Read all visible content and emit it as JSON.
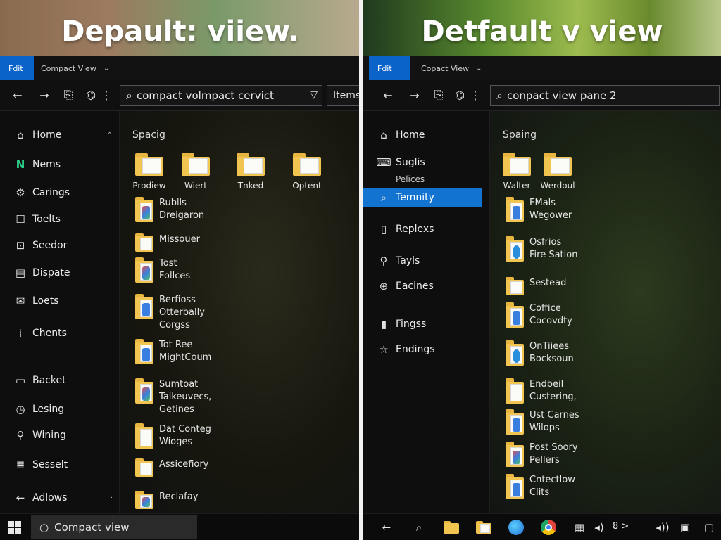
{
  "left": {
    "banner_title": "Depault: viiew.",
    "app_tab": "Fdit",
    "view_label": "Compact View",
    "search_value": "compact volmpact cervict",
    "items_label": "Items",
    "sidebar": [
      {
        "icon": "home-icon",
        "label": "Home",
        "glyph": "⌂"
      },
      {
        "icon": "news-icon",
        "label": "Nems",
        "glyph": "N"
      },
      {
        "icon": "settings-icon",
        "label": "Carings",
        "glyph": "⚙"
      },
      {
        "icon": "tools-icon",
        "label": "Toelts",
        "glyph": "☐"
      },
      {
        "icon": "selector-icon",
        "label": "Seedor",
        "glyph": "⊡"
      },
      {
        "icon": "document-icon",
        "label": "Dispate",
        "glyph": "▤"
      },
      {
        "icon": "mail-icon",
        "label": "Loets",
        "glyph": "✉"
      },
      {
        "icon": "grid-icon",
        "label": "Chents",
        "glyph": "⁞"
      },
      {
        "icon": "monitor-icon",
        "label": "Backet",
        "glyph": "▭"
      },
      {
        "icon": "clock-icon",
        "label": "Lesing",
        "glyph": "◷"
      },
      {
        "icon": "wrench-icon",
        "label": "Wining",
        "glyph": "⚲"
      },
      {
        "icon": "list-icon",
        "label": "Sesselt",
        "glyph": "≣"
      },
      {
        "icon": "back-arrow-icon",
        "label": "Adlows",
        "glyph": "←"
      }
    ],
    "section_title": "Spacig",
    "grid": [
      "Prodiew",
      "Wiert",
      "Tnked",
      "Optent"
    ],
    "list": [
      {
        "lines": [
          "Rublls",
          "Dreigaron"
        ],
        "mark": "colors"
      },
      {
        "lines": [
          "Missouer"
        ],
        "mark": "none"
      },
      {
        "lines": [
          "Tost",
          "Follces"
        ],
        "mark": "colors"
      },
      {
        "lines": [
          "Berfioss",
          "Otterbally",
          "Corgss"
        ],
        "mark": "blue"
      },
      {
        "lines": [
          "Tot Ree",
          "MightCoum"
        ],
        "mark": "blue"
      },
      {
        "lines": [
          "Sumtoat",
          "Talkeuvecs,",
          "Getines"
        ],
        "mark": "colors"
      },
      {
        "lines": [
          "Dat Conteg",
          "Wioges"
        ],
        "mark": "none"
      },
      {
        "lines": [
          "Assicefiory"
        ],
        "mark": "none"
      },
      {
        "lines": [
          "Reclafay"
        ],
        "mark": "colors"
      }
    ],
    "taskbar_search": "Compact view"
  },
  "right": {
    "banner_title": "Detfault v view",
    "app_tab": "Fdit",
    "view_label": "Copact View",
    "search_value": "conpact view pane 2",
    "sidebar": [
      {
        "icon": "home-icon",
        "label": "Home",
        "glyph": "⌂"
      },
      {
        "icon": "keyboard-icon",
        "label": "Suglis",
        "glyph": "⌨"
      },
      {
        "icon": "terminal-icon",
        "label": "Temnity",
        "glyph": "⌕"
      },
      {
        "icon": "document-icon",
        "label": "Replexs",
        "glyph": "▯"
      },
      {
        "icon": "tools-icon",
        "label": "Tayls",
        "glyph": "⚲"
      },
      {
        "icon": "globe-icon",
        "label": "Eacines",
        "glyph": "⊕"
      },
      {
        "icon": "bookmark-icon",
        "label": "Fingss",
        "glyph": "▮"
      },
      {
        "icon": "star-icon",
        "label": "Endings",
        "glyph": "☆"
      }
    ],
    "sidebar_sub": "Pelices",
    "section_title": "Spaing",
    "grid": [
      "Walter",
      "Werdoul"
    ],
    "list": [
      {
        "lines": [
          "FMals",
          "Wegower"
        ],
        "mark": "blue"
      },
      {
        "lines": [
          "Osfrios",
          "Fire Sation"
        ],
        "mark": "edge"
      },
      {
        "lines": [
          "Sestead"
        ],
        "mark": "none"
      },
      {
        "lines": [
          "Coffice",
          "Cocovdty"
        ],
        "mark": "blue"
      },
      {
        "lines": [
          "OnTiiees",
          "Bocksoun"
        ],
        "mark": "edge"
      },
      {
        "lines": [
          "Endbeil",
          "Custering,"
        ],
        "mark": "none"
      },
      {
        "lines": [
          "Ust Carnes",
          "Wilops"
        ],
        "mark": "blue"
      },
      {
        "lines": [
          "Post Soory",
          "Pellers"
        ],
        "mark": "colors"
      },
      {
        "lines": [
          "Cntectlow",
          "Clits"
        ],
        "mark": "blue"
      }
    ],
    "tray": "8 >"
  },
  "colors": {
    "accent": "#1373d1",
    "folder": "#f2c550"
  }
}
